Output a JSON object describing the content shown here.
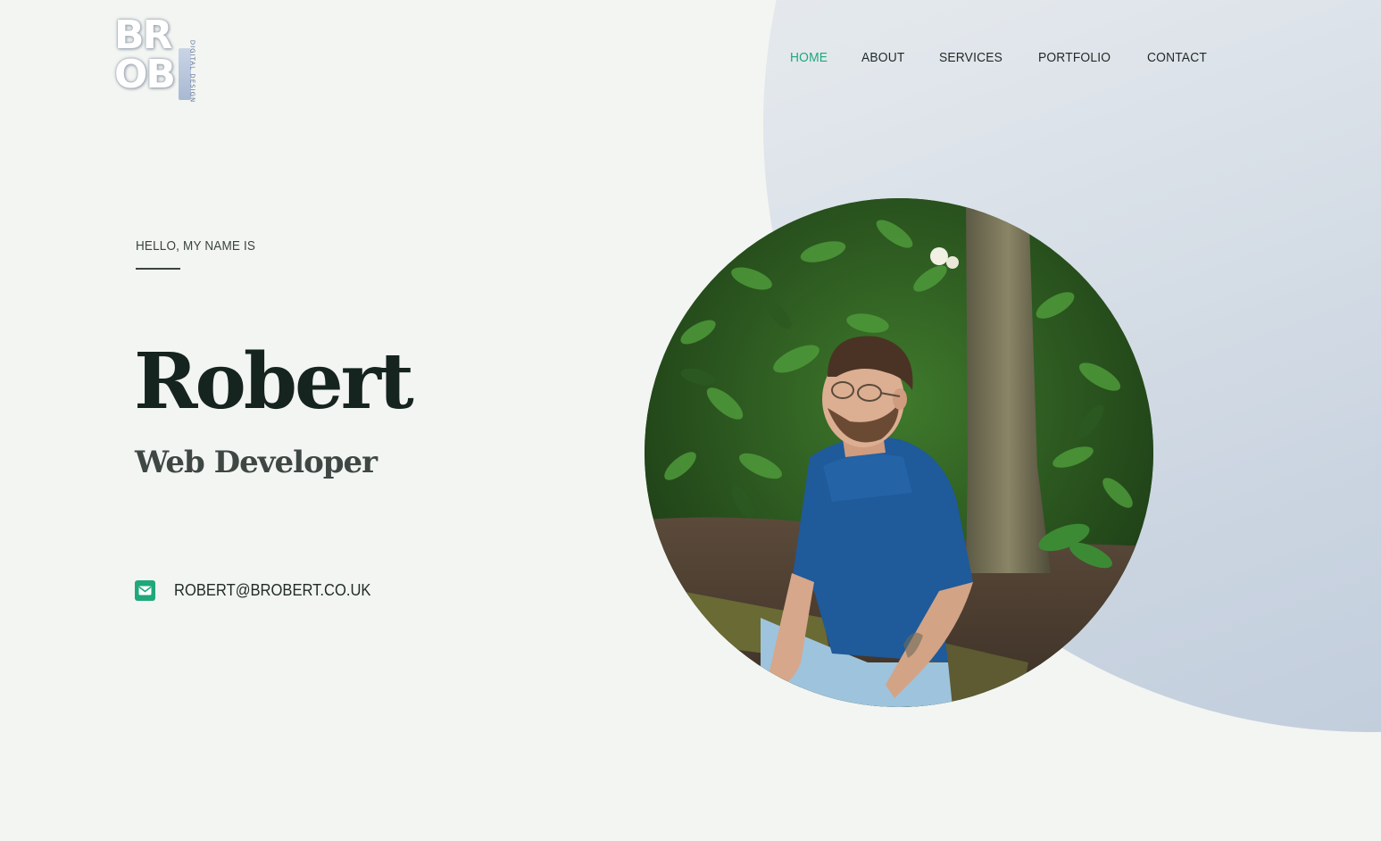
{
  "logo": {
    "text_line1": "BR",
    "text_line2": "OB",
    "side_text": "DIGITAL DESIGN"
  },
  "nav": {
    "items": [
      {
        "label": "HOME",
        "active": true
      },
      {
        "label": "ABOUT",
        "active": false
      },
      {
        "label": "SERVICES",
        "active": false
      },
      {
        "label": "PORTFOLIO",
        "active": false
      },
      {
        "label": "CONTACT",
        "active": false
      }
    ]
  },
  "hero": {
    "greeting": "HELLO, MY NAME IS",
    "name": "Robert",
    "role": "Web Developer",
    "email": "ROBERT@BROBERT.CO.UK",
    "email_icon": "envelope-icon"
  },
  "portrait": {
    "subject": "man in blue t-shirt sitting in front of green shrubbery and tree trunk"
  },
  "colors": {
    "background": "#f3f5f2",
    "accent": "#1fa87a",
    "heading": "#15241f",
    "circle_gradient_end": "#bcc9da"
  }
}
